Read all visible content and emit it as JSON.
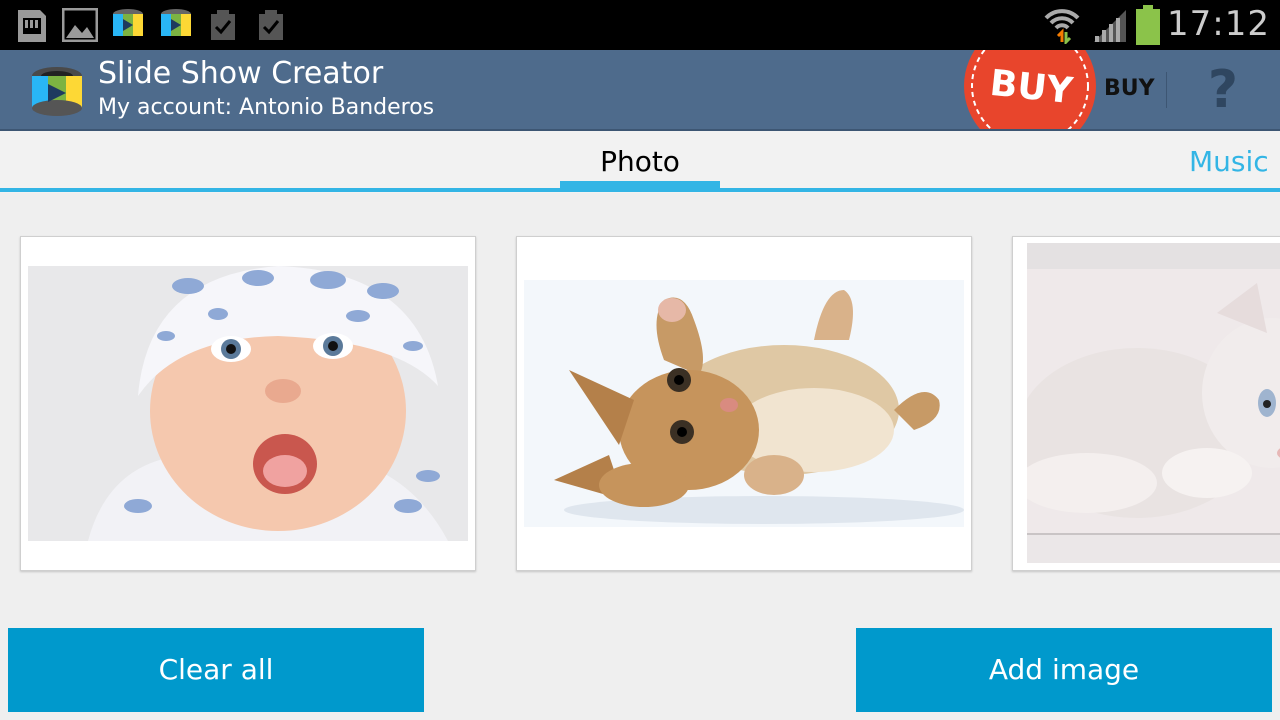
{
  "status_bar": {
    "time": "17:12",
    "icons": [
      "sd-card-icon",
      "gallery-icon",
      "app-notification-icon",
      "app-notification-icon",
      "checkbox-notification-icon",
      "checkbox-notification-icon",
      "wifi-icon",
      "signal-icon",
      "battery-icon"
    ]
  },
  "action_bar": {
    "title": "Slide Show Creator",
    "subtitle": "My account: Antonio Banderos",
    "buy_badge_text": "BUY",
    "buy_label": "BUY",
    "help_glyph": "?"
  },
  "tabs": {
    "items": [
      {
        "label": "Photo",
        "selected": true
      },
      {
        "label": "Music",
        "selected": false
      }
    ]
  },
  "photos": [
    {
      "subject": "baby"
    },
    {
      "subject": "kitten"
    },
    {
      "subject": "white-kitten"
    }
  ],
  "buttons": {
    "clear_all": "Clear all",
    "add_image": "Add image"
  },
  "colors": {
    "action_bar": "#4e6b8c",
    "accent": "#33b5e5",
    "button": "#0099cc",
    "buy_badge": "#e8452c"
  }
}
